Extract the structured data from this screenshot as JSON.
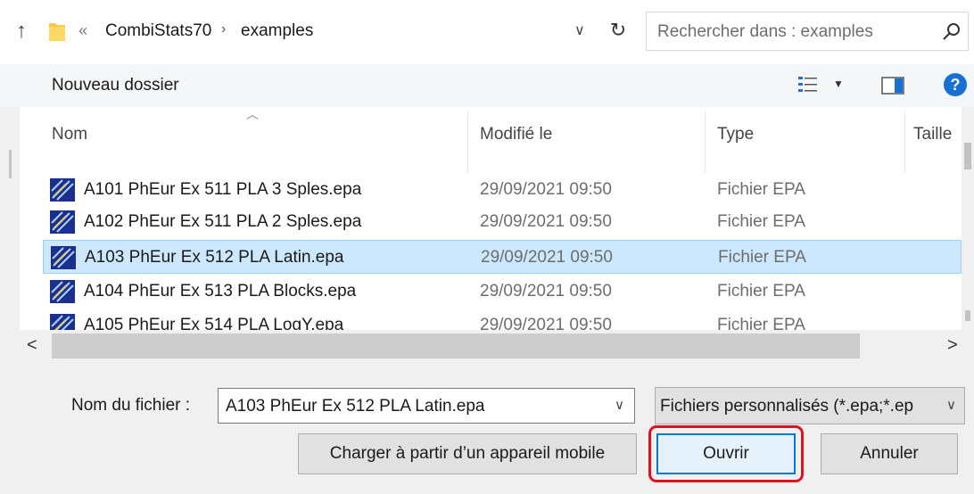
{
  "address": {
    "chevron": "«",
    "breadcrumbs": [
      "CombiStats70",
      "examples"
    ],
    "separator": "›",
    "dropdown_icon": "chevron-down-icon",
    "refresh_icon": "refresh-icon"
  },
  "search": {
    "placeholder": "Rechercher dans : examples"
  },
  "toolbar": {
    "new_folder": "Nouveau dossier"
  },
  "columns": {
    "name": "Nom",
    "modified": "Modifié le",
    "type": "Type",
    "size": "Taille"
  },
  "files": [
    {
      "name": "A101 PhEur Ex 511 PLA 3 Sples.epa",
      "modified": "29/09/2021 09:50",
      "type": "Fichier EPA"
    },
    {
      "name": "A102 PhEur Ex 511 PLA 2 Sples.epa",
      "modified": "29/09/2021 09:50",
      "type": "Fichier EPA"
    },
    {
      "name": "A103 PhEur Ex 512 PLA Latin.epa",
      "modified": "29/09/2021 09:50",
      "type": "Fichier EPA",
      "selected": true
    },
    {
      "name": "A104 PhEur Ex 513 PLA Blocks.epa",
      "modified": "29/09/2021 09:50",
      "type": "Fichier EPA"
    },
    {
      "name": "A105 PhEur Ex 514 PLA LogY.epa",
      "modified": "29/09/2021 09:50",
      "type": "Fichier EPA"
    }
  ],
  "filename": {
    "label": "Nom du fichier :",
    "value": "A103 PhEur Ex 512 PLA Latin.epa"
  },
  "filter": {
    "value": "Fichiers personnalisés (*.epa;*.ep"
  },
  "buttons": {
    "mobile": "Charger à partir d’un appareil mobile",
    "open": "Ouvrir",
    "cancel": "Annuler"
  },
  "colors": {
    "selection": "#cce8ff",
    "accent": "#0078d7",
    "highlight": "#e2101c",
    "help": "#1870d5"
  }
}
